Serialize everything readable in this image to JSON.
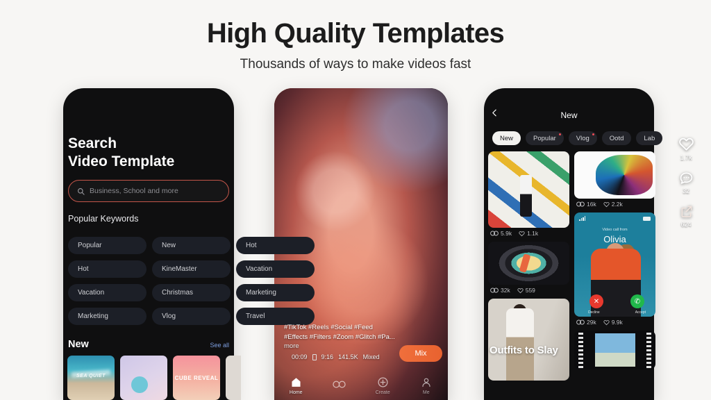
{
  "header": {
    "title": "High Quality Templates",
    "subtitle": "Thousands of ways to make videos fast"
  },
  "left_phone": {
    "title_line1": "Search",
    "title_line2": "Video Template",
    "search": {
      "icon": "search-icon",
      "placeholder": "Business, School and more",
      "value": "",
      "border_color": "#c4564a"
    },
    "keywords_label": "Popular Keywords",
    "chips": [
      "Popular",
      "New",
      "Hot",
      "Hot",
      "KineMaster",
      "Vacation",
      "Vacation",
      "Christmas",
      "Marketing",
      "Marketing",
      "Vlog",
      "Travel"
    ],
    "section": {
      "title": "New",
      "see_all": "See all",
      "see_all_color": "#7e9fe0"
    },
    "thumbnails": [
      {
        "caption": "SEA QUIET",
        "style": "beach"
      },
      {
        "caption": "",
        "style": "pastel"
      },
      {
        "caption": "CUBE REVEAL",
        "style": "cube"
      }
    ]
  },
  "center_phone": {
    "actions": [
      {
        "icon": "heart-icon",
        "count": "1.7k"
      },
      {
        "icon": "comment-icon",
        "count": "32"
      },
      {
        "icon": "share-icon",
        "count": "624"
      }
    ],
    "tags_line1": "#TikTok #Reels #Social #Feed",
    "tags_line2": "#Effects #Filters #Zoom #Glitch #Pa...",
    "more_label": "more",
    "mix_button": "Mix",
    "mix_color": "#ea6733",
    "meta": {
      "duration": "00:09",
      "ratio": "9:16",
      "uses": "141.5K",
      "type": "Mixed"
    },
    "navbar": [
      {
        "icon": "home-icon",
        "label": "Home",
        "active": true
      },
      {
        "icon": "loop-icon",
        "label": "",
        "active": false
      },
      {
        "icon": "create-icon",
        "label": "Create",
        "active": false
      },
      {
        "icon": "profile-icon",
        "label": "Me",
        "active": false
      }
    ]
  },
  "right_phone": {
    "back_icon": "chevron-left-icon",
    "title": "New",
    "tabs": [
      {
        "label": "New",
        "active": true,
        "badge": false
      },
      {
        "label": "Popular",
        "active": false,
        "badge": true
      },
      {
        "label": "Vlog",
        "active": false,
        "badge": true
      },
      {
        "label": "Ootd",
        "active": false,
        "badge": false
      },
      {
        "label": "Lab",
        "active": false,
        "badge": false
      }
    ],
    "cards": [
      {
        "style": "mural",
        "views": "5.9k",
        "likes": "1.1k",
        "caption": ""
      },
      {
        "style": "gradient",
        "views": "16k",
        "likes": "2.2k",
        "caption": ""
      },
      {
        "style": "lens",
        "views": "32k",
        "likes": "559",
        "caption": ""
      },
      {
        "style": "call",
        "views": "29k",
        "likes": "9.9k",
        "caption": ""
      },
      {
        "style": "outfit",
        "views": "",
        "likes": "",
        "caption": "Outfits to Slay"
      },
      {
        "style": "film",
        "views": "",
        "likes": "",
        "caption": ""
      }
    ],
    "call_card": {
      "from_label": "Video call from",
      "name": "Olivia",
      "decline_label": "Decline",
      "accept_label": "Accept",
      "decline_color": "#e8392e",
      "accept_color": "#21b84b"
    }
  },
  "theme": {
    "background": "#f7f6f4",
    "phone_bg": "#0f0f10",
    "text_primary": "#1c1c1c"
  }
}
